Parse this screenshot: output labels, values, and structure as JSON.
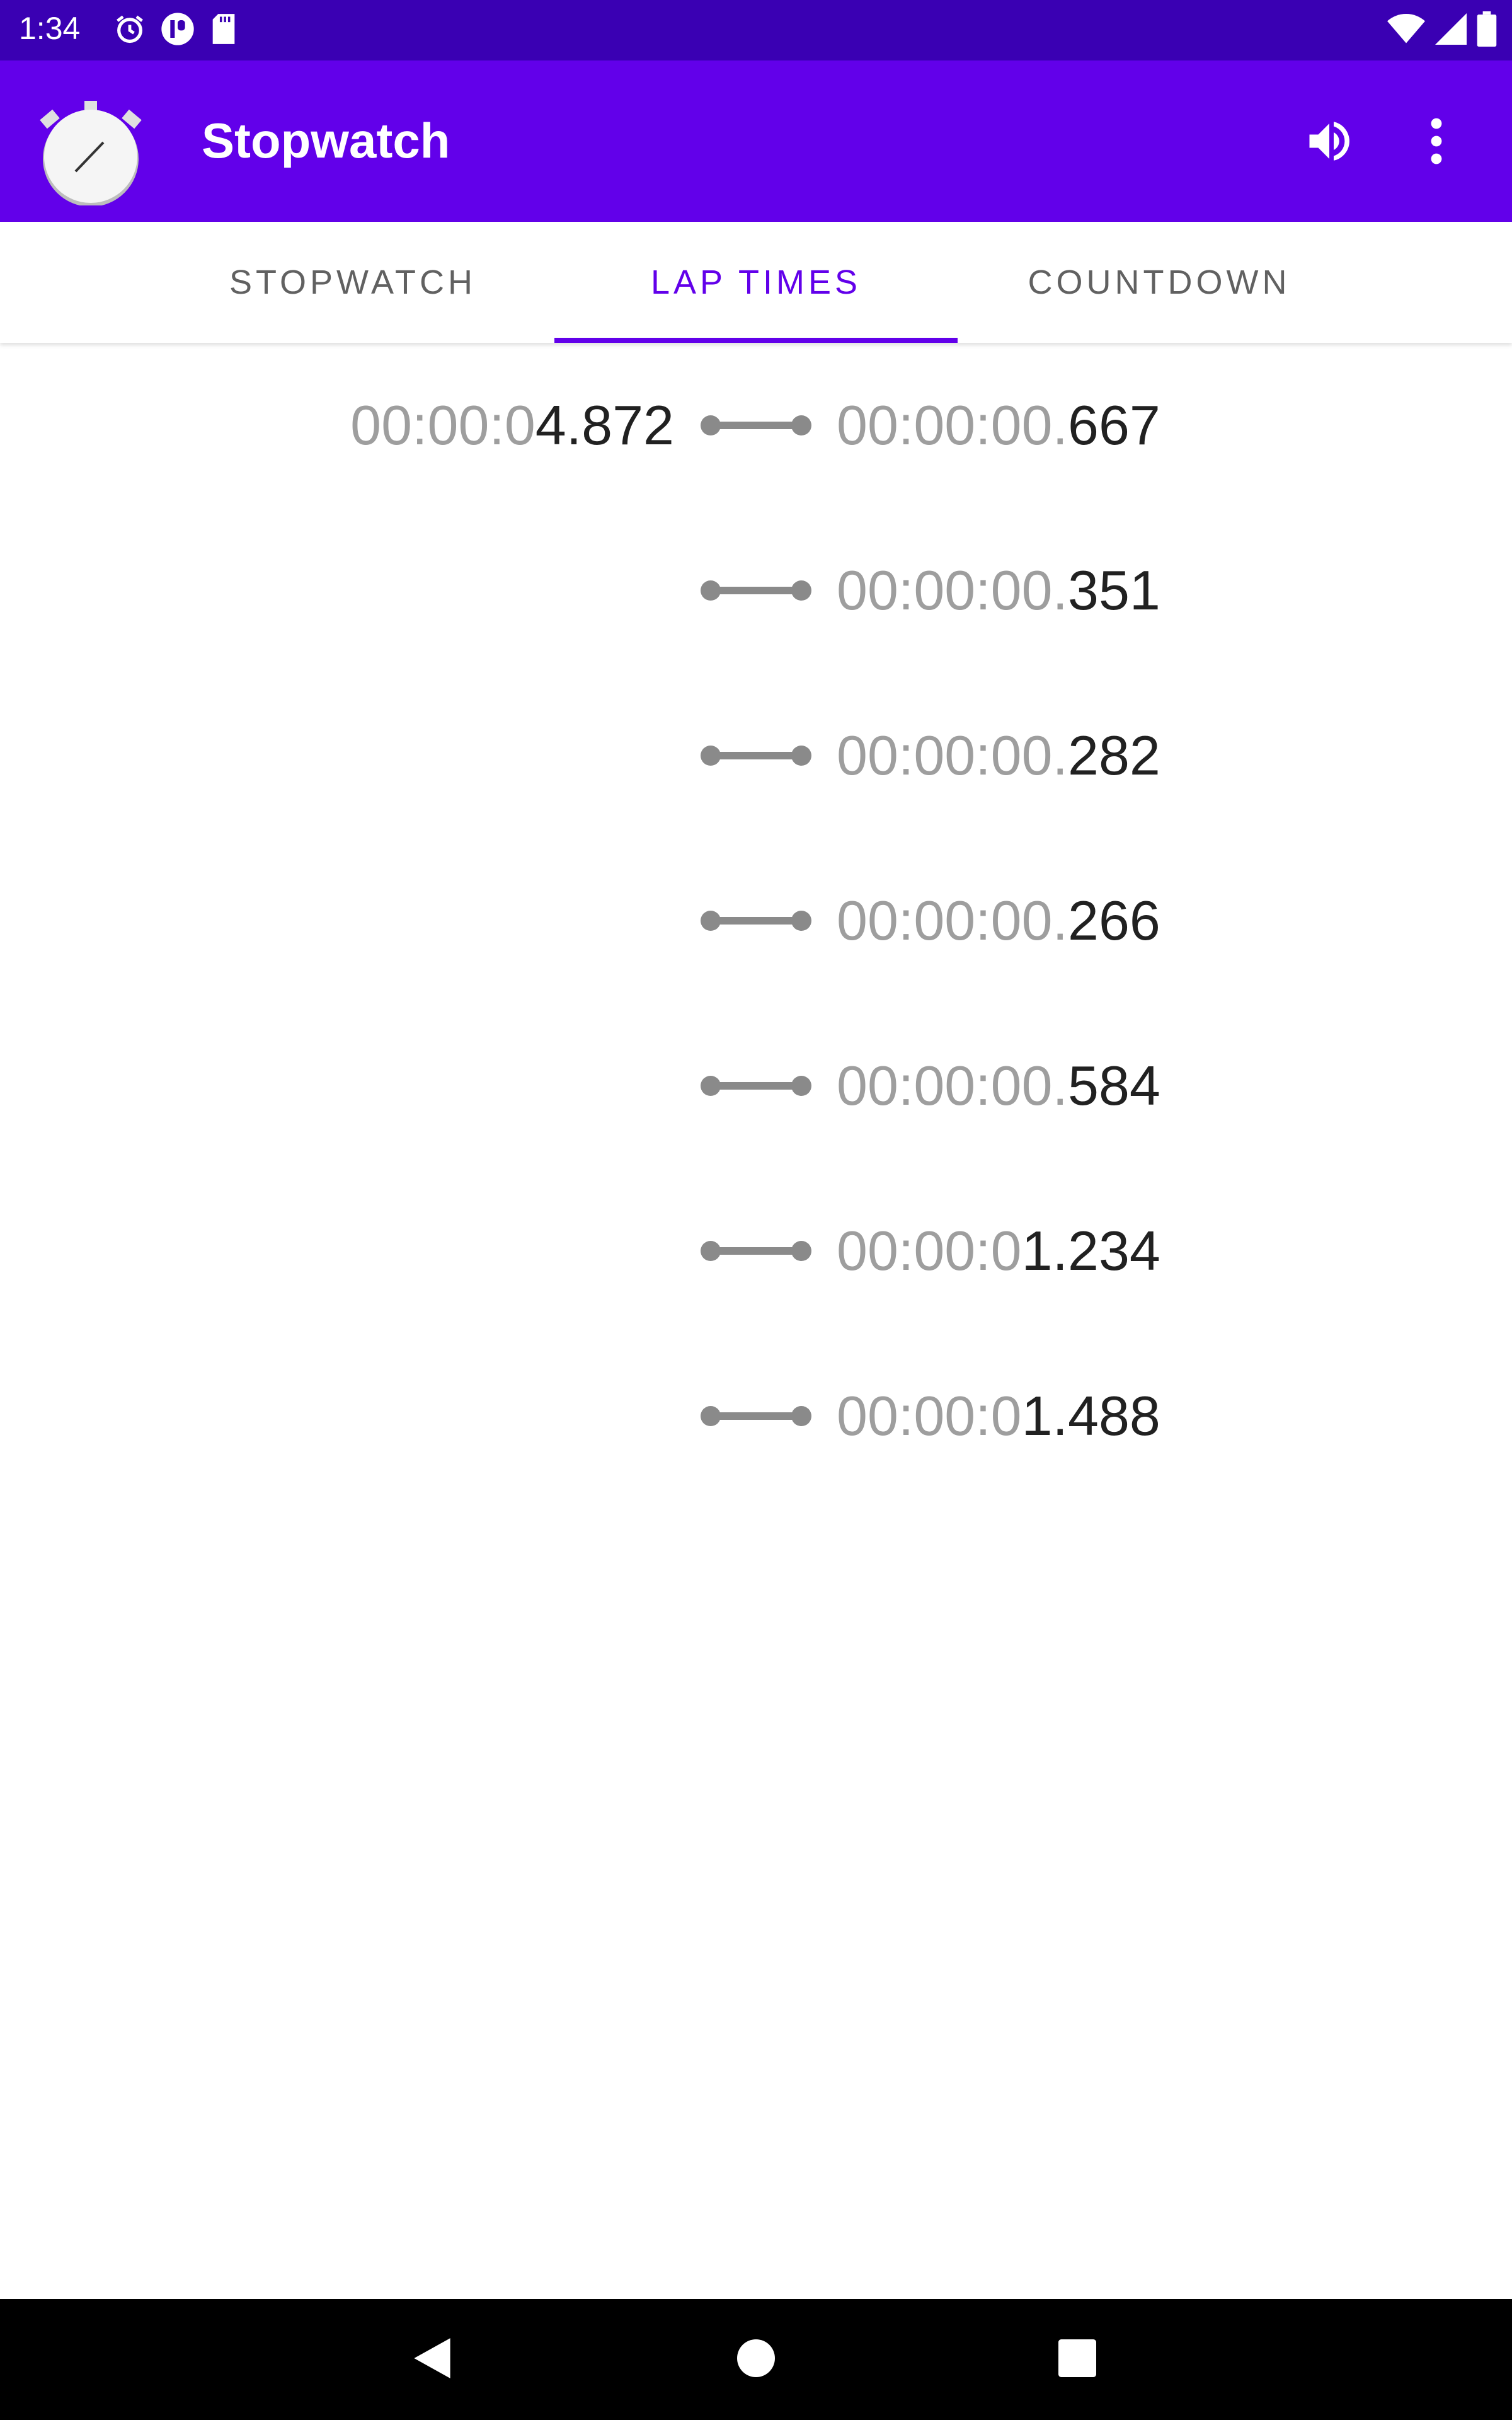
{
  "status_bar": {
    "time": "1:34",
    "icons_left": [
      "alarm-icon",
      "app-notification-icon",
      "sd-card-icon"
    ],
    "icons_right": [
      "wifi-icon",
      "cell-signal-icon",
      "battery-icon"
    ]
  },
  "app_bar": {
    "title": "Stopwatch",
    "actions": [
      "volume-icon",
      "overflow-menu-icon"
    ]
  },
  "tabs": [
    {
      "label": "STOPWATCH",
      "selected": false
    },
    {
      "label": "LAP TIMES",
      "selected": true
    },
    {
      "label": "COUNTDOWN",
      "selected": false
    }
  ],
  "laps": [
    {
      "total_dim": "00:00:0",
      "total_main": "4.872",
      "split_dim": "00:00:00.",
      "split_main": "667"
    },
    {
      "total_dim": "",
      "total_main": "",
      "split_dim": "00:00:00.",
      "split_main": "351"
    },
    {
      "total_dim": "",
      "total_main": "",
      "split_dim": "00:00:00.",
      "split_main": "282"
    },
    {
      "total_dim": "",
      "total_main": "",
      "split_dim": "00:00:00.",
      "split_main": "266"
    },
    {
      "total_dim": "",
      "total_main": "",
      "split_dim": "00:00:00.",
      "split_main": "584"
    },
    {
      "total_dim": "",
      "total_main": "",
      "split_dim": "00:00:0",
      "split_main": "1.234"
    },
    {
      "total_dim": "",
      "total_main": "",
      "split_dim": "00:00:0",
      "split_main": "1.488"
    }
  ],
  "nav_bar": {
    "buttons": [
      "back-icon",
      "home-icon",
      "recents-icon"
    ]
  },
  "colors": {
    "status_bar": "#3a00b3",
    "app_bar": "#6200ea",
    "accent": "#6200ea",
    "tab_inactive": "#616161",
    "time_dim": "#9e9e9e",
    "time_main": "#212121",
    "connector": "#8a8a8a"
  }
}
